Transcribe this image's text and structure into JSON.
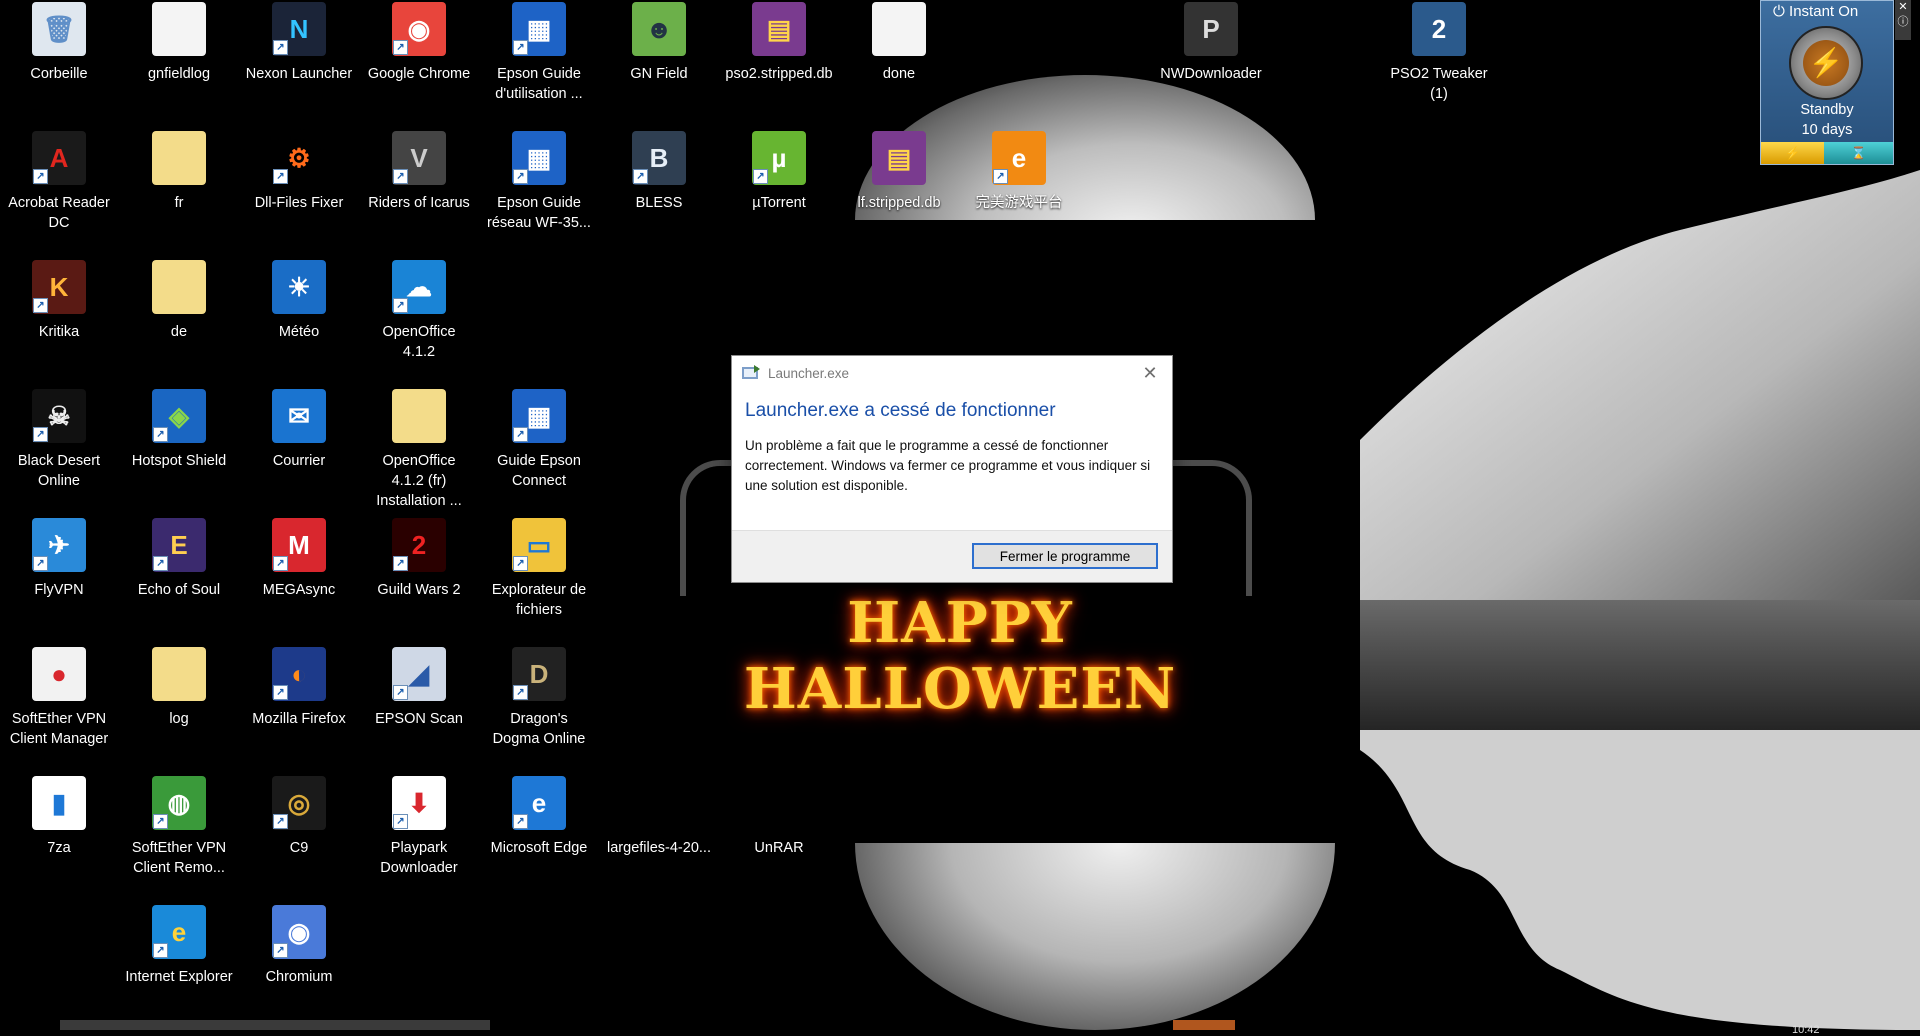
{
  "desktop": {
    "icons": [
      {
        "id": "corbeille",
        "label": "Corbeille",
        "glyph": "🗑",
        "bg": "#dfe7ef",
        "fg": "#5f8fc8",
        "shortcut": false
      },
      {
        "id": "gnfieldlog",
        "label": "gnfieldlog",
        "glyph": "",
        "bg": "#f4f4f4",
        "fg": "#888",
        "shortcut": false
      },
      {
        "id": "nexon-launcher",
        "label": "Nexon Launcher",
        "glyph": "N",
        "bg": "#1b2438",
        "fg": "#33c3ff",
        "shortcut": true
      },
      {
        "id": "google-chrome",
        "label": "Google Chrome",
        "glyph": "◉",
        "bg": "#e8453c",
        "fg": "#fff",
        "shortcut": true
      },
      {
        "id": "epson-guide-1",
        "label": "Epson Guide d'utilisation ...",
        "glyph": "▦",
        "bg": "#1e63c6",
        "fg": "#fff",
        "shortcut": true
      },
      {
        "id": "gn-field",
        "label": "GN Field",
        "glyph": "☻",
        "bg": "#6cb04a",
        "fg": "#234",
        "shortcut": false
      },
      {
        "id": "pso2-stripped-db",
        "label": "pso2.stripped.db",
        "glyph": "▤",
        "bg": "#7a3b8f",
        "fg": "#ffd54a",
        "shortcut": false
      },
      {
        "id": "done",
        "label": "done",
        "glyph": "",
        "bg": "#f4f4f4",
        "fg": "#888",
        "shortcut": false
      },
      {
        "id": "nwdownloader",
        "label": "NWDownloader",
        "glyph": "P",
        "bg": "#333",
        "fg": "#ddd",
        "shortcut": false
      },
      {
        "id": "pso2-tweaker",
        "label": "PSO2 Tweaker (1)",
        "glyph": "2",
        "bg": "#2b5a8c",
        "fg": "#fff",
        "shortcut": false
      },
      {
        "id": "acrobat",
        "label": "Acrobat Reader DC",
        "glyph": "A",
        "bg": "#1a1a1a",
        "fg": "#e0261e",
        "shortcut": true
      },
      {
        "id": "fr",
        "label": "fr",
        "glyph": "",
        "bg": "#f3dc8a",
        "fg": "#bbb",
        "shortcut": false
      },
      {
        "id": "dll-files-fixer",
        "label": "Dll-Files Fixer",
        "glyph": "⚙",
        "bg": "#000",
        "fg": "#ff6a1a",
        "shortcut": true
      },
      {
        "id": "riders-of-icarus",
        "label": "Riders of Icarus",
        "glyph": "V",
        "bg": "#444",
        "fg": "#ccc",
        "shortcut": true
      },
      {
        "id": "epson-guide-2",
        "label": "Epson Guide réseau WF-35...",
        "glyph": "▦",
        "bg": "#1e63c6",
        "fg": "#fff",
        "shortcut": true
      },
      {
        "id": "bless",
        "label": "BLESS",
        "glyph": "B",
        "bg": "#2f3f52",
        "fg": "#e6eef7",
        "shortcut": true
      },
      {
        "id": "utorrent",
        "label": "µTorrent",
        "glyph": "µ",
        "bg": "#67b531",
        "fg": "#fff",
        "shortcut": true
      },
      {
        "id": "lf-stripped-db",
        "label": "lf.stripped.db",
        "glyph": "▤",
        "bg": "#7a3b8f",
        "fg": "#ffd54a",
        "shortcut": false
      },
      {
        "id": "game-platform",
        "label": "完美游戏平台",
        "glyph": "e",
        "bg": "#f28a12",
        "fg": "#fff",
        "shortcut": true
      },
      {
        "id": "kritika",
        "label": "Kritika",
        "glyph": "K",
        "bg": "#5a1a14",
        "fg": "#ffb43a",
        "shortcut": true
      },
      {
        "id": "de",
        "label": "de",
        "glyph": "",
        "bg": "#f3dc8a",
        "fg": "#bbb",
        "shortcut": false
      },
      {
        "id": "meteo",
        "label": "Météo",
        "glyph": "☀",
        "bg": "#1a6dc6",
        "fg": "#fff",
        "shortcut": false
      },
      {
        "id": "openoffice",
        "label": "OpenOffice 4.1.2",
        "glyph": "☁",
        "bg": "#1a84d6",
        "fg": "#fff",
        "shortcut": true
      },
      {
        "id": "black-desert",
        "label": "Black Desert Online",
        "glyph": "☠",
        "bg": "#111",
        "fg": "#eee",
        "shortcut": true
      },
      {
        "id": "hotspot-shield",
        "label": "Hotspot Shield",
        "glyph": "◈",
        "bg": "#1a66c2",
        "fg": "#8ad64a",
        "shortcut": true
      },
      {
        "id": "courrier",
        "label": "Courrier",
        "glyph": "✉",
        "bg": "#1a74d0",
        "fg": "#fff",
        "shortcut": false
      },
      {
        "id": "openoffice-install",
        "label": "OpenOffice 4.1.2 (fr) Installation ...",
        "glyph": "",
        "bg": "#f3dc8a",
        "fg": "#bbb",
        "shortcut": false
      },
      {
        "id": "guide-epson-connect",
        "label": "Guide Epson Connect",
        "glyph": "▦",
        "bg": "#1e63c6",
        "fg": "#fff",
        "shortcut": true
      },
      {
        "id": "flyvpn",
        "label": "FlyVPN",
        "glyph": "✈",
        "bg": "#2a8ad9",
        "fg": "#fff",
        "shortcut": true
      },
      {
        "id": "echo-of-soul",
        "label": "Echo of Soul",
        "glyph": "E",
        "bg": "#3b2a6e",
        "fg": "#ffcf50",
        "shortcut": true
      },
      {
        "id": "megasync",
        "label": "MEGAsync",
        "glyph": "M",
        "bg": "#d9272e",
        "fg": "#fff",
        "shortcut": true
      },
      {
        "id": "guild-wars-2",
        "label": "Guild Wars 2",
        "glyph": "2",
        "bg": "#2a0000",
        "fg": "#e22",
        "shortcut": true
      },
      {
        "id": "explorateur",
        "label": "Explorateur de fichiers",
        "glyph": "▭",
        "bg": "#f0c33a",
        "fg": "#1e78d6",
        "shortcut": true
      },
      {
        "id": "softether-manager",
        "label": "SoftEther VPN Client Manager",
        "glyph": "●",
        "bg": "#f2f2f2",
        "fg": "#d9272e",
        "shortcut": false
      },
      {
        "id": "log",
        "label": "log",
        "glyph": "",
        "bg": "#f3dc8a",
        "fg": "#bbb",
        "shortcut": false
      },
      {
        "id": "firefox",
        "label": "Mozilla Firefox",
        "glyph": "◐",
        "bg": "#1d3a8a",
        "fg": "#ff8a1a",
        "shortcut": true
      },
      {
        "id": "epson-scan",
        "label": "EPSON Scan",
        "glyph": "◢",
        "bg": "#cfd8e6",
        "fg": "#2a5aa8",
        "shortcut": true
      },
      {
        "id": "dragons-dogma",
        "label": "Dragon's Dogma Online",
        "glyph": "D",
        "bg": "#222",
        "fg": "#c9b27a",
        "shortcut": true
      },
      {
        "id": "7za",
        "label": "7za",
        "glyph": "▮",
        "bg": "#ffffff",
        "fg": "#1e78d6",
        "shortcut": false
      },
      {
        "id": "softether-remote",
        "label": "SoftEther VPN Client Remo...",
        "glyph": "◍",
        "bg": "#3a9a3a",
        "fg": "#fff",
        "shortcut": true
      },
      {
        "id": "c9",
        "label": "C9",
        "glyph": "◎",
        "bg": "#1a1a1a",
        "fg": "#d9a93a",
        "shortcut": true
      },
      {
        "id": "playpark",
        "label": "Playpark Downloader",
        "glyph": "⬇",
        "bg": "#ffffff",
        "fg": "#d9272e",
        "shortcut": true
      },
      {
        "id": "edge",
        "label": "Microsoft Edge",
        "glyph": "e",
        "bg": "#1e78d6",
        "fg": "#fff",
        "shortcut": true
      },
      {
        "id": "largefiles",
        "label": "largefiles-4-20...",
        "glyph": "",
        "bg": "transparent",
        "fg": "#888",
        "shortcut": false
      },
      {
        "id": "unrar",
        "label": "UnRAR",
        "glyph": "",
        "bg": "transparent",
        "fg": "#888",
        "shortcut": false
      },
      {
        "id": "internet-explorer",
        "label": "Internet Explorer",
        "glyph": "e",
        "bg": "#1a8ad9",
        "fg": "#ffd23a",
        "shortcut": true
      },
      {
        "id": "chromium",
        "label": "Chromium",
        "glyph": "◉",
        "bg": "#4a7ad9",
        "fg": "#fff",
        "shortcut": true
      }
    ]
  },
  "halloween_banner": {
    "text": "HAPPY HALLOWEEN"
  },
  "dialog": {
    "title": "Launcher.exe",
    "close_glyph": "✕",
    "heading": "Launcher.exe a cessé de fonctionner",
    "body": "Un problème a fait que le programme a cessé de fonctionner correctement. Windows va fermer ce programme et vous indiquer si une solution est disponible.",
    "button": "Fermer le programme"
  },
  "gadget": {
    "header": "Instant On",
    "power_glyph": "⏻",
    "status_line1": "Standby",
    "status_line2": "10 days",
    "bar_left_glyph": "⚡",
    "bar_right_glyph": "⌛",
    "colors": {
      "accent": "#3d6ea0"
    }
  },
  "taskbar": {
    "clock_fragment": "10:42"
  }
}
